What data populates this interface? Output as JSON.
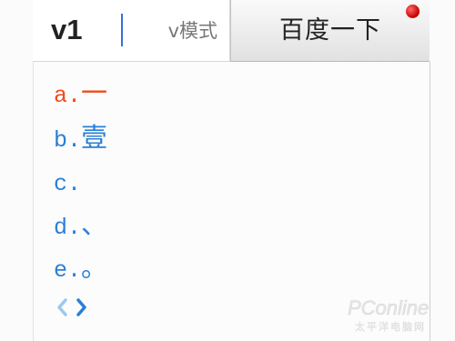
{
  "search": {
    "query": "v1",
    "mode_label": "v模式"
  },
  "button": {
    "label": "百度一下"
  },
  "candidates": [
    {
      "index": "a.",
      "text": "一",
      "selected": true
    },
    {
      "index": "b.",
      "text": "壹",
      "selected": false
    },
    {
      "index": "c.",
      "text": "",
      "selected": false
    },
    {
      "index": "d.",
      "text": "、",
      "selected": false
    },
    {
      "index": "e.",
      "text": "。",
      "selected": false
    }
  ],
  "pager": {
    "prev_icon": "chevron-left-icon",
    "next_icon": "chevron-right-icon"
  },
  "colors": {
    "selected": "#f04a1a",
    "candidate": "#2a7fd6",
    "pager_prev": "#9ec8ee",
    "pager_next": "#2a7fd6"
  },
  "watermark": {
    "logo_text": "PConline",
    "sub_text": "太平洋电脑网"
  }
}
